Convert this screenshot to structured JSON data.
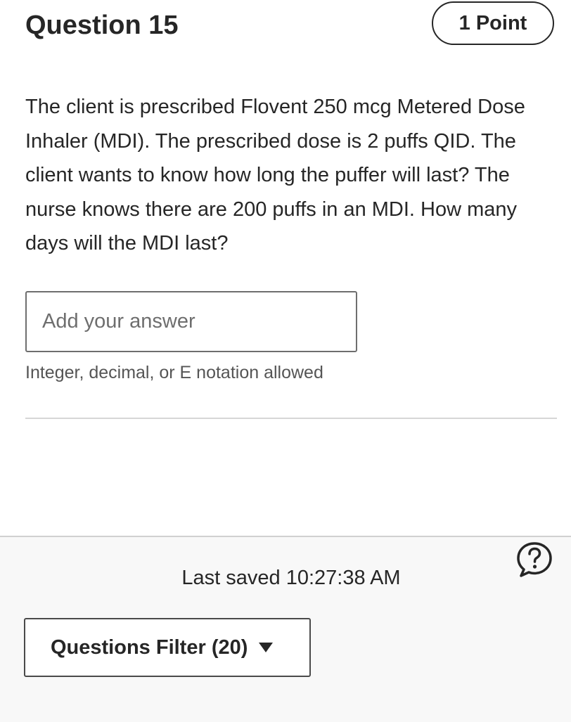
{
  "question": {
    "title": "Question 15",
    "points": "1 Point",
    "text": "The client is prescribed Flovent 250 mcg Metered Dose Inhaler (MDI). The prescribed dose is 2 puffs QID. The client wants to know how long the puffer will last? The nurse knows there are 200 puffs in an MDI. How many days will the MDI last?"
  },
  "answer": {
    "value": "",
    "placeholder": "Add your answer",
    "helper": "Integer, decimal, or E notation allowed"
  },
  "footer": {
    "last_saved_label": "Last saved",
    "last_saved_time": "10:27:38 AM",
    "filter_label": "Questions Filter (20)",
    "help_icon": "help-question-icon"
  }
}
